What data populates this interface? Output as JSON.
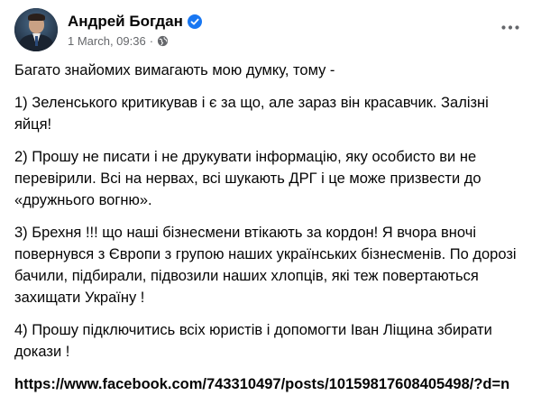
{
  "author": {
    "name": "Андрей Богдан",
    "timestamp": "1 March, 09:36",
    "separator": "·",
    "verified_icon": "verified-badge-icon",
    "audience_icon": "globe-icon"
  },
  "menu_icon": "more-options-icon",
  "colors": {
    "verified": "#1877f2",
    "meta_text": "#65676b",
    "text": "#050505"
  },
  "paragraphs": [
    "Багато знайомих вимагають мою думку, тому -",
    "1) Зеленського критикував і є за що, але зараз він красавчик. Залізні яйця!",
    "2) Прошу не писати і не друкувати інформацію, яку особисто ви не перевірили. Всі на нервах, всі шукають ДРГ і це може призвести до «дружнього вогню».",
    "3) Брехня !!! що наші бізнесмени втікають за кордон! Я вчора вночі повернувся з Європи з групою наших українських бізнесменів. По дорозі бачили, підбирали, підвозили наших хлопців, які теж повертаються захищати Україну !",
    "4) Прошу підключитись всіх юристів і допомогти Іван Ліщина збирати докази !"
  ],
  "link": "https://www.facebook.com/743310497/posts/10159817608405498/?d=n"
}
